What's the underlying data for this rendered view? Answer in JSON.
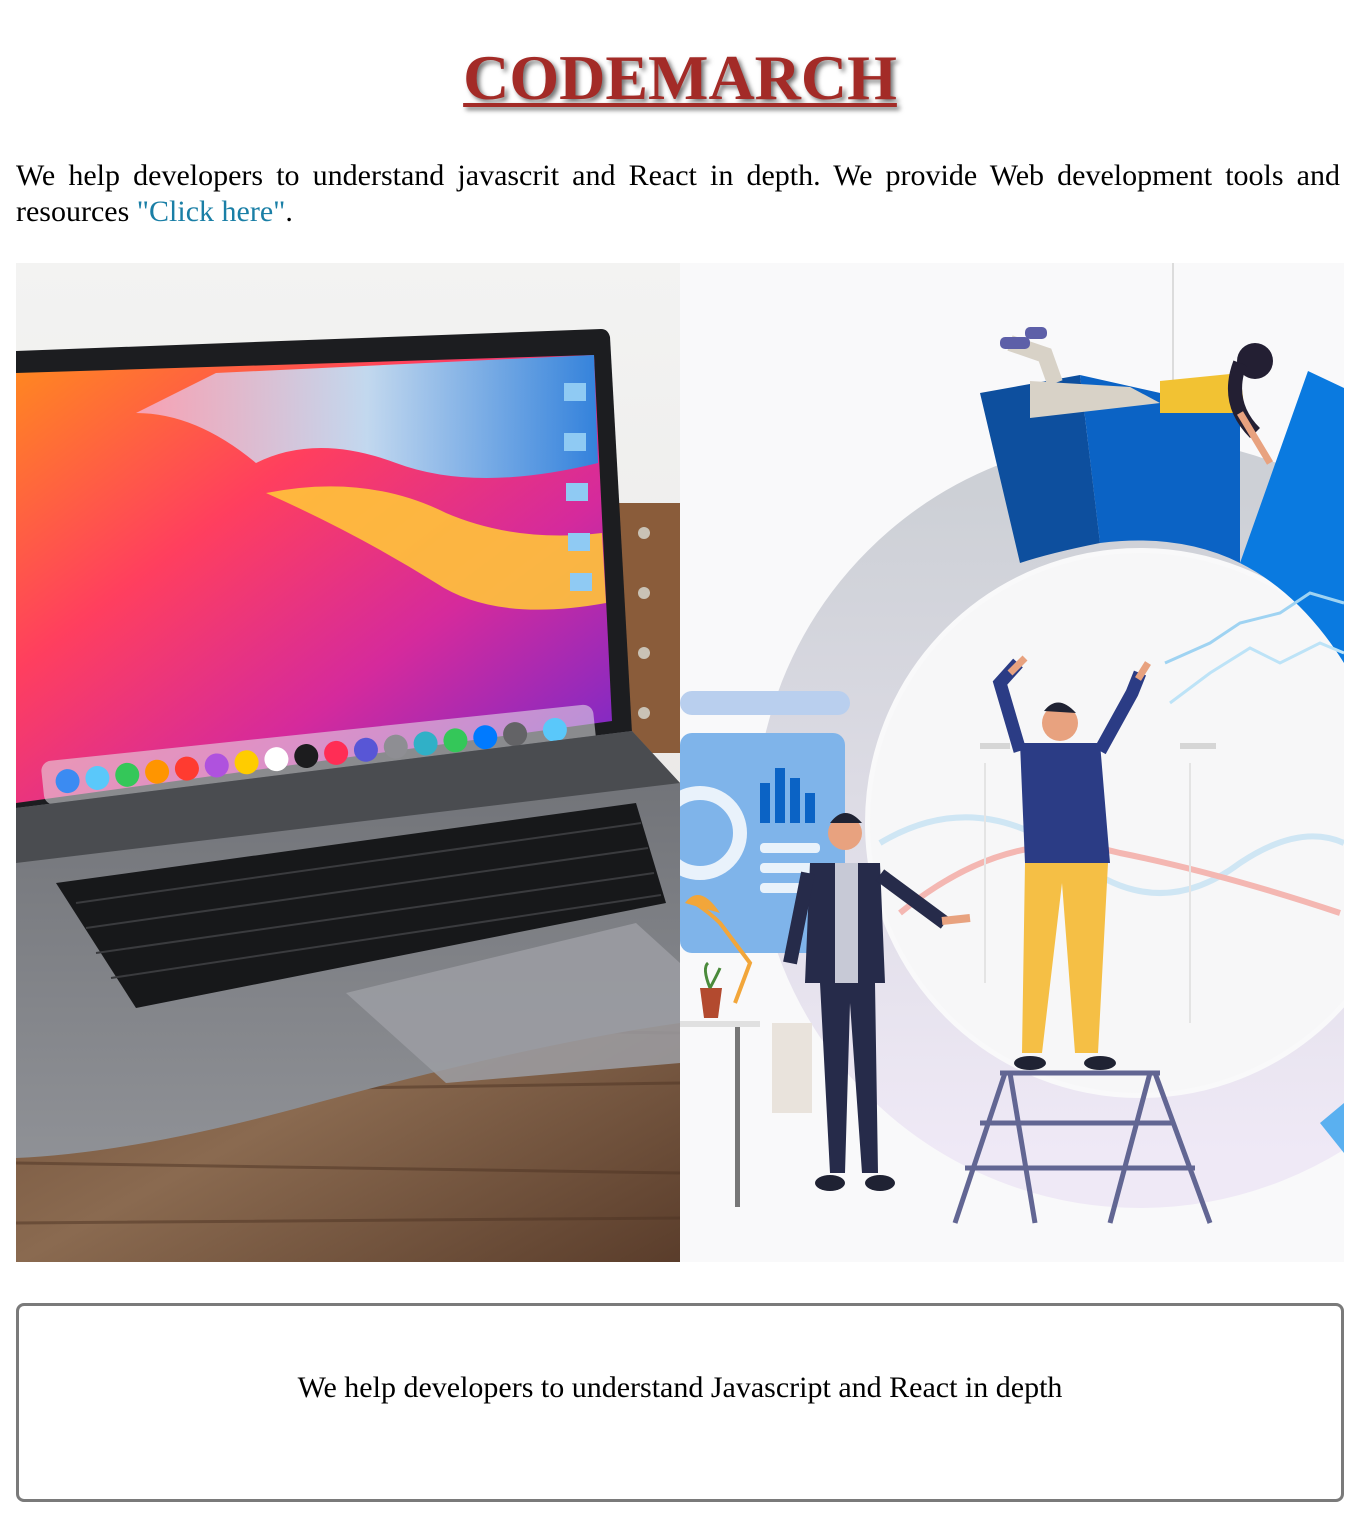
{
  "header": {
    "title": "CODEMARCH"
  },
  "intro": {
    "text": "We help developers to understand javascrit and React in depth. We provide Web development tools and resources ",
    "link_label": "\"Click here\"",
    "trailing": "."
  },
  "gallery": {
    "images": [
      {
        "icon": "laptop-photo"
      },
      {
        "icon": "team-analytics-illustration"
      }
    ]
  },
  "info_box": {
    "text": "We help developers to understand Javascript and React in depth"
  },
  "colors": {
    "title": "#a32b27",
    "link": "#1a7fa6",
    "border": "#7a7a7a"
  }
}
